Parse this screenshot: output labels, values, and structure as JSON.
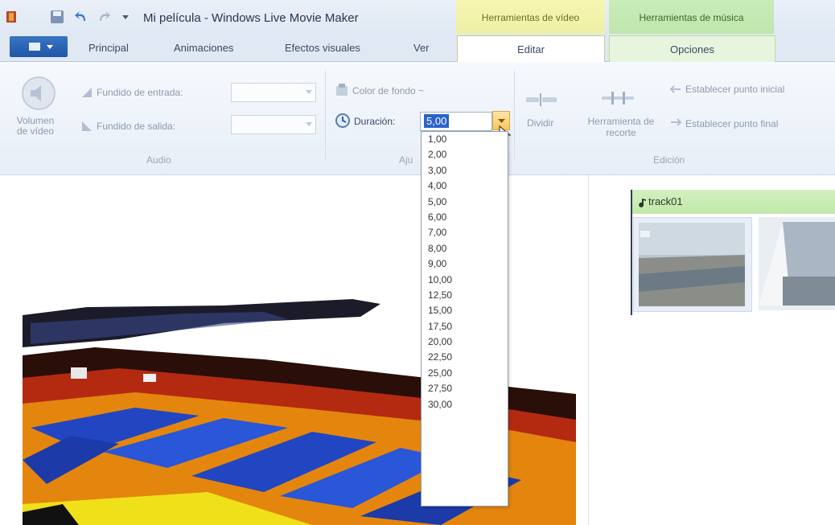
{
  "titlebar": {
    "title": "Mi película - Windows Live Movie Maker",
    "contextual_tabs": [
      "Herramientas de vídeo",
      "Herramientas de música"
    ]
  },
  "tabs": [
    "Principal",
    "Animaciones",
    "Efectos visuales",
    "Ver",
    "Editar",
    "Opciones"
  ],
  "ribbon": {
    "audio": {
      "volume_label": "Volumen de vídeo",
      "fade_in_label": "Fundido de entrada:",
      "fade_out_label": "Fundido de salida:",
      "group_label": "Audio"
    },
    "ajustes": {
      "bg_color_label": "Color de fondo ~",
      "duration_label": "Duración:",
      "duration_value": "5,00",
      "group_label": "Ajustes"
    },
    "edicion": {
      "split_label": "Dividir",
      "trim_label": "Herramienta de recorte",
      "set_start_label": "Establecer punto inicial",
      "set_end_label": "Establecer punto final",
      "group_label": "Edición"
    }
  },
  "duration_options": [
    "1,00",
    "2,00",
    "3,00",
    "4,00",
    "5,00",
    "6,00",
    "7,00",
    "8,00",
    "9,00",
    "10,00",
    "12,50",
    "15,00",
    "17,50",
    "20,00",
    "22,50",
    "25,00",
    "27,50",
    "30,00"
  ],
  "storyboard": {
    "track_label": "track01",
    "note_icon": "music-note-icon"
  },
  "colors": {
    "video_tools": "#f7f5b0",
    "music_tools": "#c9ecb9",
    "selection": "#2a63c9",
    "accent_blue": "#1f57a8"
  }
}
